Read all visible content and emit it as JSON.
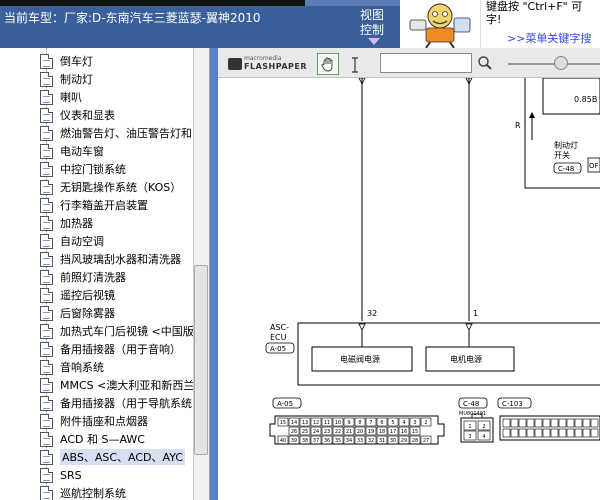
{
  "header": {
    "car_model": "当前车型：厂家:D-东南汽车三菱蓝瑟-翼神2010",
    "view_control_line1": "视图",
    "view_control_line2": "控制",
    "tip_line1": "键盘按 \"Ctrl+F\" 可",
    "tip_line2": "字!",
    "tip_link": ">>菜单关键字搜"
  },
  "tree": {
    "items": [
      {
        "label": "倒车灯"
      },
      {
        "label": "制动灯"
      },
      {
        "label": "喇叭"
      },
      {
        "label": "仪表和显表"
      },
      {
        "label": "燃油警告灯、油压警告灯和"
      },
      {
        "label": "电动车窗"
      },
      {
        "label": "中控门锁系统"
      },
      {
        "label": "无钥匙操作系统（KOS）"
      },
      {
        "label": "行李箱盖开启装置"
      },
      {
        "label": "加热器"
      },
      {
        "label": "自动空调"
      },
      {
        "label": "挡风玻璃刮水器和清洗器"
      },
      {
        "label": "前照灯清洗器"
      },
      {
        "label": "遥控后视镜"
      },
      {
        "label": "后窗除雾器"
      },
      {
        "label": "加热式车门后视镜 <中国版"
      },
      {
        "label": "备用插接器（用于音响）"
      },
      {
        "label": "音响系统"
      },
      {
        "label": "MMCS <澳大利亚和新西兰"
      },
      {
        "label": "备用插接器（用于导航系统"
      },
      {
        "label": "附件插座和点烟器"
      },
      {
        "label": "ACD 和 S—AWC"
      },
      {
        "label": "ABS、ASC、ACD、AYC"
      },
      {
        "label": "SRS"
      },
      {
        "label": "巡航控制系统"
      }
    ],
    "selected_index": 22
  },
  "toolbar": {
    "logo_small": "macromedia",
    "logo_big": "FLASHPAPER",
    "hand_tool_icon": "hand-icon",
    "select_tool_icon": "text-cursor-icon",
    "search_icon": "magnifier-icon",
    "search_value": ""
  },
  "diagram": {
    "value_085": "0.85B",
    "label_R": "R",
    "brake_switch_line1": "制动灯",
    "brake_switch_line2": "开关",
    "connector_c48_top": "C-48",
    "of_label": "OF",
    "pin_32": "32",
    "pin_1": "1",
    "ecu_name1": "ASC-",
    "ecu_name2": "ECU",
    "ecu_connector": "A-05",
    "box1_label": "电磁阀电源",
    "box2_label": "电机电源",
    "conn_a05": "A-05",
    "conn_c48": "C-48",
    "conn_c48_sub": "MU801491",
    "conn_c103": "C-103",
    "c48_pins": [
      "1",
      "2",
      "3",
      "4"
    ],
    "a05_row1": [
      "15",
      "14",
      "13",
      "12",
      "11",
      "10",
      "9",
      "8",
      "7",
      "6",
      "5",
      "4",
      "3",
      "2"
    ],
    "a05_row2": [
      "26",
      "25",
      "24",
      "23",
      "22",
      "21",
      "20",
      "19",
      "18",
      "17",
      "16",
      "15"
    ],
    "a05_row3": [
      "40",
      "39",
      "38",
      "37",
      "36",
      "35",
      "34",
      "33",
      "32",
      "31",
      "30",
      "29",
      "28",
      "27"
    ]
  }
}
